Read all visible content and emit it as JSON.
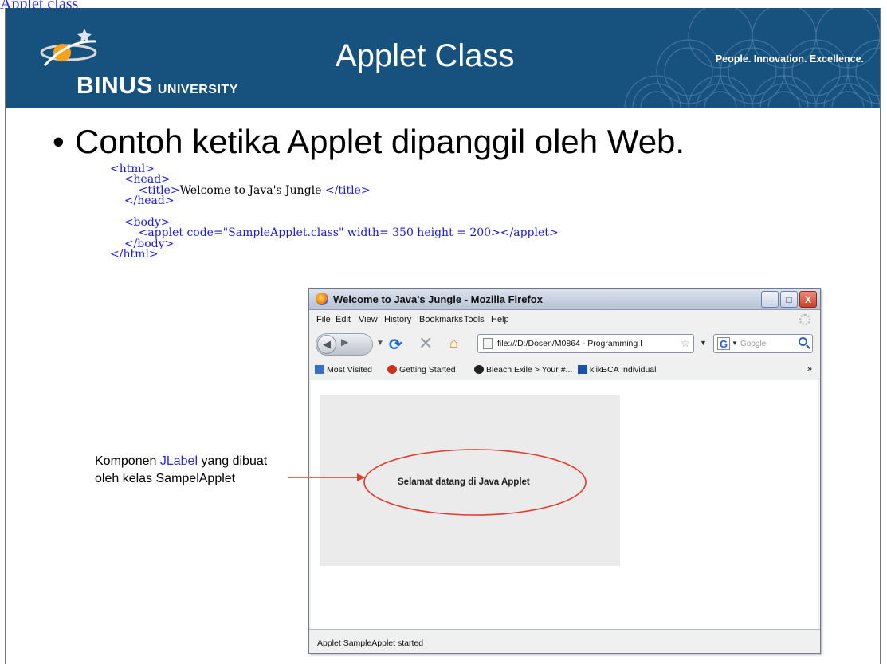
{
  "page": {
    "top_link": "Applet class"
  },
  "slide": {
    "banner": {
      "logo_big": "BINUS",
      "logo_small": "UNIVERSITY",
      "title": "Applet Class",
      "tagline": "People. Innovation. Excellence."
    },
    "bullet": "Contoh ketika Applet dipanggil oleh Web.",
    "code_lines": [
      {
        "indent": "",
        "parts": [
          {
            "t": "tag",
            "v": "<html>"
          }
        ]
      },
      {
        "indent": "    ",
        "parts": [
          {
            "t": "tag",
            "v": "<head>"
          }
        ]
      },
      {
        "indent": "        ",
        "parts": [
          {
            "t": "tag",
            "v": "<title>"
          },
          {
            "t": "txt",
            "v": "Welcome to Java's Jungle "
          },
          {
            "t": "tag",
            "v": "</title>"
          }
        ]
      },
      {
        "indent": "    ",
        "parts": [
          {
            "t": "tag",
            "v": "</head>"
          }
        ]
      },
      {
        "indent": "",
        "parts": []
      },
      {
        "indent": "    ",
        "parts": [
          {
            "t": "tag",
            "v": "<body>"
          }
        ]
      },
      {
        "indent": "        ",
        "parts": [
          {
            "t": "tag",
            "v": "<applet code="
          },
          {
            "t": "str",
            "v": "\"SampleApplet.class\""
          },
          {
            "t": "tag",
            "v": " width= 350 height = 200></applet>"
          }
        ]
      },
      {
        "indent": "    ",
        "parts": [
          {
            "t": "tag",
            "v": "</body>"
          }
        ]
      },
      {
        "indent": "",
        "parts": [
          {
            "t": "tag",
            "v": "</html>"
          }
        ]
      }
    ],
    "annotation": {
      "line1_pre": "Komponen ",
      "line1_highlight": "JLabel",
      "line1_post": " yang dibuat",
      "line2": "oleh kelas SampelApplet"
    },
    "colors": {
      "banner": "#17517e",
      "code_tag": "#1a1adf",
      "annotation_ring": "#e03a2a"
    }
  },
  "browser": {
    "window_title": "Welcome to Java's Jungle - Mozilla Firefox",
    "menu": [
      "File",
      "Edit",
      "View",
      "History",
      "Bookmarks",
      "Tools",
      "Help"
    ],
    "url": "file:///D:/Dosen/M0864 - Programming I",
    "search_placeholder": "Google",
    "search_engine_icon": "G",
    "bookmarks": [
      {
        "label": "Most Visited",
        "icon": "most-visited-icon"
      },
      {
        "label": "Getting Started",
        "icon": "getting-started-icon"
      },
      {
        "label": "Bleach Exile > Your #...",
        "icon": "bleach-icon"
      },
      {
        "label": "klikBCA Individual",
        "icon": "klikbca-icon"
      }
    ],
    "bookmarks_overflow": "»",
    "applet_label": "Selamat datang di Java Applet",
    "status": "Applet SampleApplet started",
    "window_buttons": {
      "minimize": "_",
      "maximize": "□",
      "close": "X"
    }
  }
}
